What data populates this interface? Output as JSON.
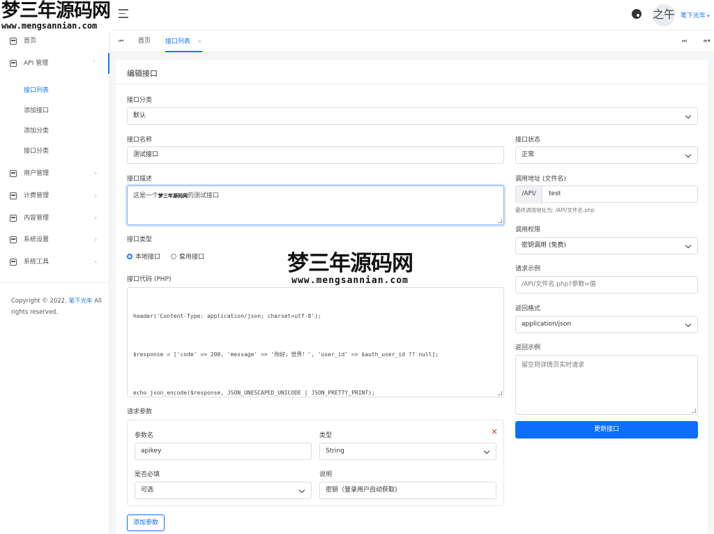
{
  "header": {
    "logo_cn": "梦三年源码网",
    "logo_en": "www.mengsannian.com",
    "avatar_text": "之午",
    "username": "笔下光年"
  },
  "sidebar": {
    "home": "首页",
    "api_group": "API 管理",
    "sub": [
      "接口列表",
      "添加接口",
      "添加分类",
      "接口分类"
    ],
    "items": [
      "用户管理",
      "计费管理",
      "内容管理",
      "系统设置",
      "系统工具"
    ],
    "copyright_prefix": "Copyright © 2022.",
    "copyright_link": "笔下光年",
    "copyright_suffix": "All rights reserved."
  },
  "tabs": {
    "home": "首页",
    "active": "接口列表",
    "close": "×"
  },
  "form": {
    "title": "编辑接口",
    "category_label": "接口分类",
    "category_value": "默认",
    "name_label": "接口名称",
    "name_value": "测试接口",
    "desc_label": "接口描述",
    "desc_prefix": "这是一个",
    "desc_wm": "梦三年源码网",
    "desc_suffix": "的测试接口",
    "type_label": "接口类型",
    "type_local": "本地接口",
    "type_proxy": "套用接口",
    "code_label": "接口代码 (PHP)",
    "code_lines": [
      "header('Content-Type: application/json; charset=utf-8');",
      "$response = ['code' => 200, 'message' => '你好，世界！', 'user_id' => $auth_user_id ?? null];",
      "echo json_encode($response, JSON_UNESCAPED_UNICODE | JSON_PRETTY_PRINT);"
    ],
    "params_label": "请求参数",
    "param_name_label": "参数名",
    "param_name_value": "apikey",
    "param_type_label": "类型",
    "param_type_value": "String",
    "param_required_label": "是否必填",
    "param_required_value": "可选",
    "param_desc_label": "说明",
    "param_desc_value": "密钥（登录用户自动获取)",
    "remove_icon": "×",
    "add_param": "添加参数",
    "status_label": "接口状态",
    "status_value": "正常",
    "url_label": "调用地址 (文件名)",
    "url_prefix": "/API/",
    "url_value": "test",
    "url_help": "最终调用地址为: /API/文件名.php",
    "perm_label": "调用权限",
    "perm_value": "密钥调用 (免费)",
    "example_label": "请求示例",
    "example_placeholder": "/API/文件名.php?参数=值",
    "format_label": "返回格式",
    "format_value": "application/json",
    "return_label": "返回示例",
    "return_placeholder": "留空则详情页实时请求",
    "submit": "更新接口"
  },
  "watermark": {
    "cn": "梦三年源码网",
    "en": "www.mengsannian.com"
  },
  "colors": {
    "accent": "#1677ff",
    "primary_button": "#0d6efd",
    "danger": "#e33333"
  }
}
